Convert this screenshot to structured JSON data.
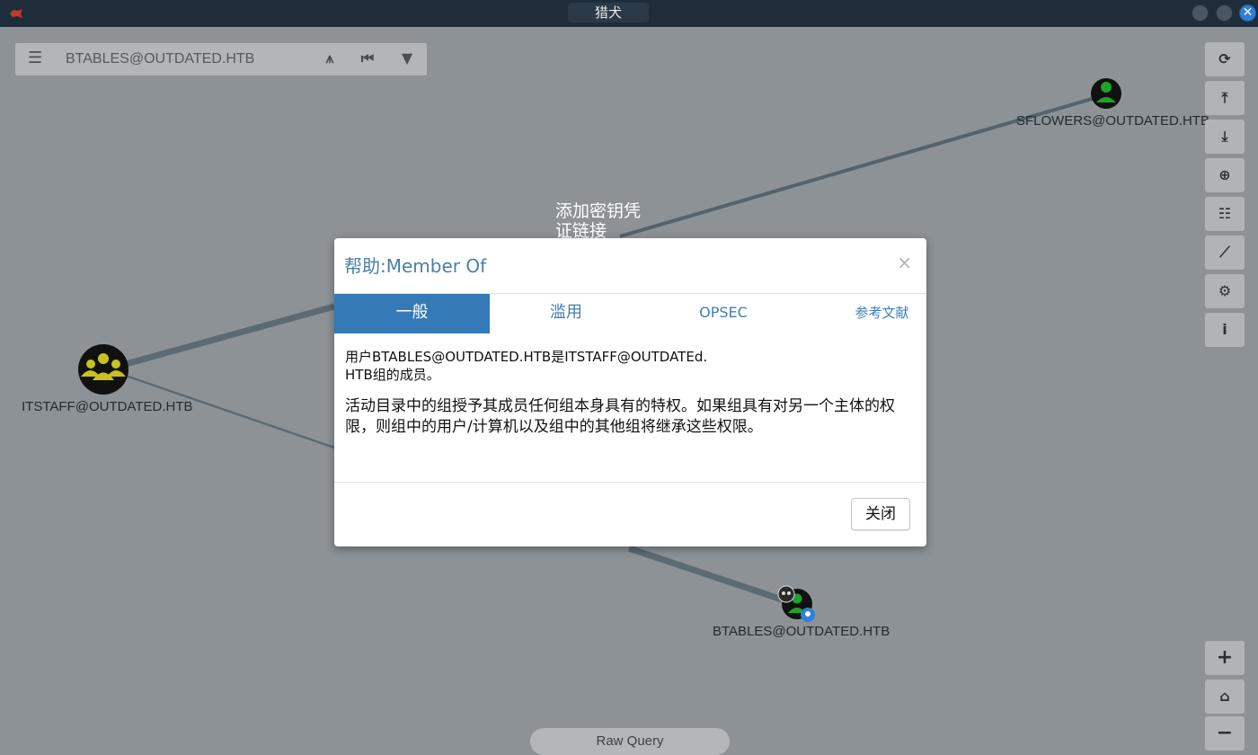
{
  "window": {
    "title": "猎犬",
    "close_glyph": "✕"
  },
  "search": {
    "menu_icon": "hamburger-icon",
    "query": "BTABLES@OUTDATED.HTB",
    "icons": [
      "pathfinding-icon",
      "back-icon",
      "filter-icon"
    ]
  },
  "right_toolbar": {
    "buttons": [
      "refresh-icon",
      "upload-icon",
      "download-icon",
      "import-icon",
      "query-list-icon",
      "stats-icon",
      "settings-icon",
      "info-icon"
    ],
    "info_glyph": "i"
  },
  "zoom": {
    "zoom_in": "+",
    "zoom_out": "−",
    "home": "home-icon"
  },
  "graph": {
    "nodes": {
      "sflowers": "SFLOWERS@OUTDATED.HTB",
      "itstaff": "ITSTAFF@OUTDATED.HTB",
      "btables": "BTABLES@OUTDATED.HTB"
    },
    "edge_label": "添加密钥凭证链接",
    "raw_query": "Raw Query"
  },
  "colors": {
    "group_node": "#c9c21a",
    "user_node": "#1fa32a",
    "active_tab": "#337ab7",
    "title_text": "#4a7fa8"
  },
  "modal": {
    "title": "帮助:Member Of",
    "close_x": "×",
    "tabs": [
      "一般",
      "滥用",
      "OPSEC",
      "参考文献"
    ],
    "active_tab": "一般",
    "para1_line1": "用户BTABLES@OUTDATED.HTB是ITSTAFF@OUTDATEd.",
    "para1_line2": "HTB组的成员。",
    "para2": "活动目录中的组授予其成员任何组本身具有的特权。如果组具有对另一个主体的权限，则组中的用户/计算机以及组中的其他组将继承这些权限。",
    "close_button": "关闭"
  }
}
